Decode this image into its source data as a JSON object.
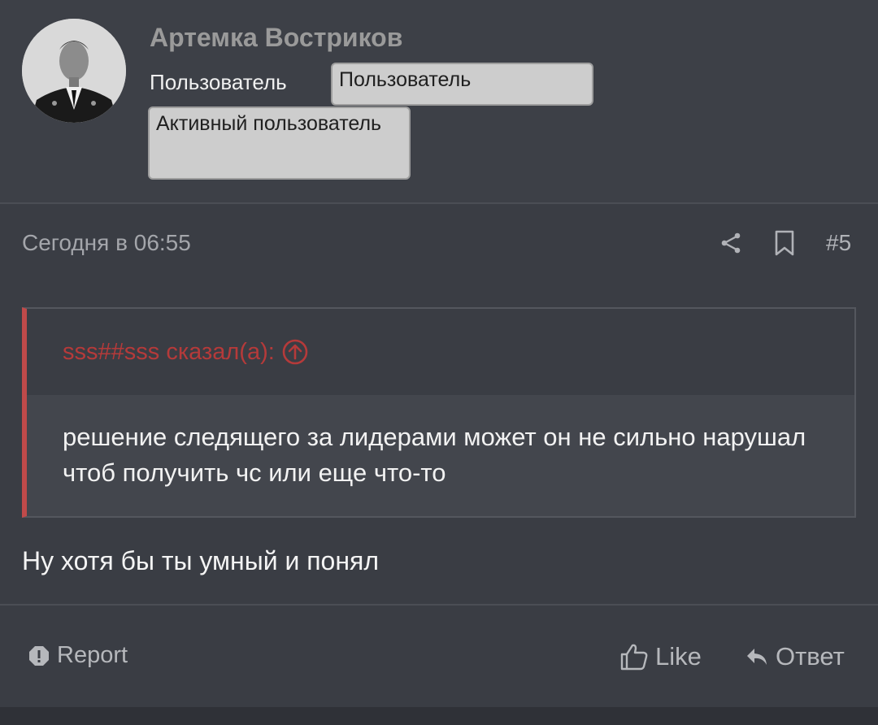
{
  "author": {
    "name": "Артемка Востриков",
    "role_label": "Пользователь",
    "badges": [
      "Пользователь",
      "Активный пользователь"
    ]
  },
  "post": {
    "date": "Сегодня в 06:55",
    "number": "#5",
    "quote": {
      "author_line": "sss##sss сказал(а):",
      "text": "решение следящего за лидерами может он не сильно нарушал чтоб получить чс или еще что-то"
    },
    "message": "Ну хотя бы ты умный и понял"
  },
  "actions": {
    "report": "Report",
    "like": "Like",
    "reply": "Ответ"
  },
  "icons": {
    "share": "share-icon",
    "bookmark": "bookmark-icon",
    "quote_jump": "arrow-up-circle-icon",
    "report": "exclamation-icon",
    "like": "thumbs-up-icon",
    "reply": "reply-arrow-icon"
  },
  "colors": {
    "background": "#3a3d44",
    "quote_accent": "#c04a4a",
    "quote_author": "#b53a3a",
    "badge_bg": "#cdcdcd"
  }
}
